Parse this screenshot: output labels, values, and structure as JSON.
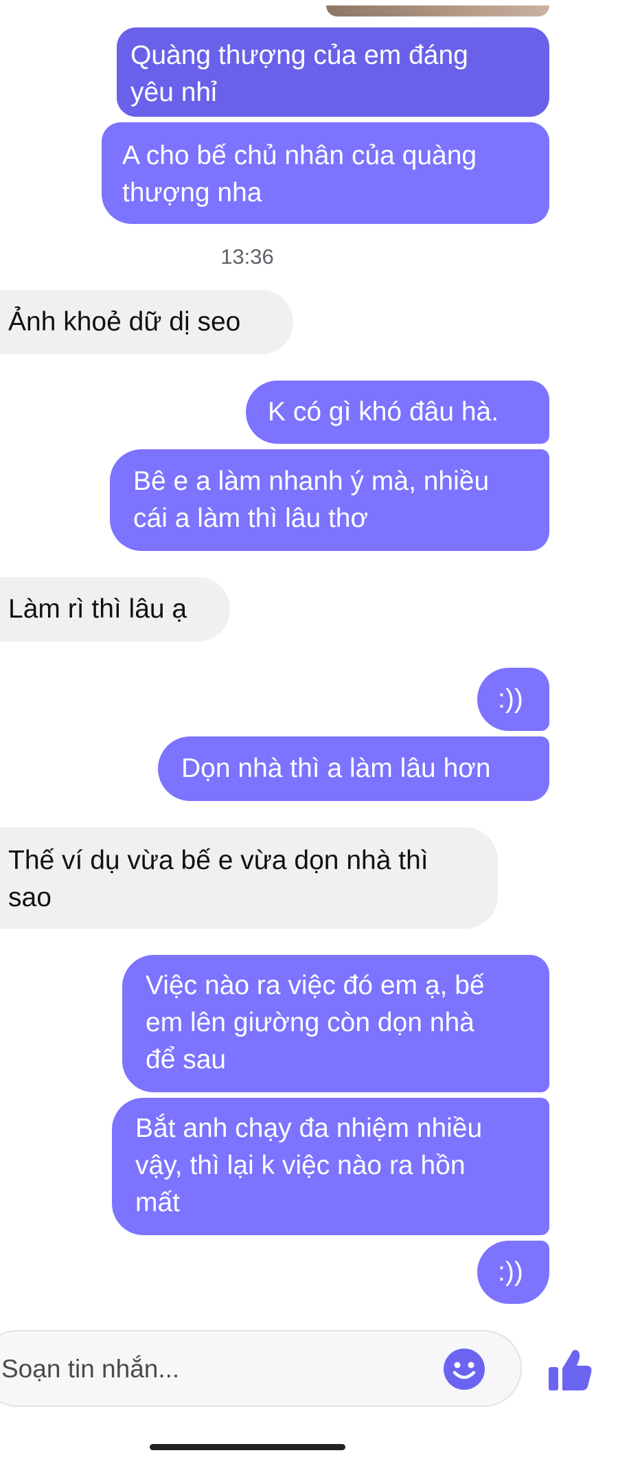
{
  "messages": [
    {
      "text": "Quàng thượng của em đáng\nyêu nhỉ",
      "direction": "outgoing"
    },
    {
      "text": "A cho bế chủ nhân của quàng\nthượng nha",
      "direction": "outgoing"
    },
    {
      "text": "Ảnh khoẻ dữ dị seo",
      "direction": "incoming"
    },
    {
      "text": "K có gì khó đâu hà.",
      "direction": "outgoing"
    },
    {
      "text": "Bê e a làm nhanh ý mà, nhiều\ncái a làm thì lâu thơ",
      "direction": "outgoing"
    },
    {
      "text": "Làm rì thì lâu ạ",
      "direction": "incoming"
    },
    {
      "text": ":))",
      "direction": "outgoing"
    },
    {
      "text": "Dọn nhà thì a làm lâu hơn",
      "direction": "outgoing"
    },
    {
      "text": "Thế ví dụ vừa bế e vừa dọn nhà thì\nsao",
      "direction": "incoming"
    },
    {
      "text": "Việc nào ra việc đó em ạ, bế\nem lên giường còn dọn nhà\nđể sau",
      "direction": "outgoing"
    },
    {
      "text": "Bắt anh chạy đa nhiệm nhiều\nvậy, thì lại k việc nào ra hồn\nmất",
      "direction": "outgoing"
    },
    {
      "text": ":))",
      "direction": "outgoing"
    }
  ],
  "timestamp": "13:36",
  "composer": {
    "placeholder": "Soạn tin nhắn..."
  },
  "icons": {
    "emoji": "smiley-icon",
    "like": "thumbs-up-icon"
  },
  "colors": {
    "outgoing_bubble": "#7c73ff",
    "incoming_bubble": "#f0f0f3",
    "accent": "#6b64f0"
  }
}
